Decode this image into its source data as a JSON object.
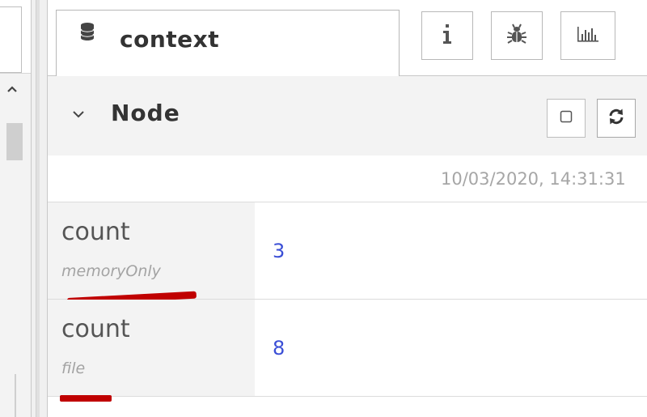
{
  "sidebar": {
    "active_tab": {
      "label": "context",
      "icon": "database-icon"
    },
    "tab_buttons": [
      {
        "name": "info-tab-button",
        "icon": "info-icon"
      },
      {
        "name": "debug-tab-button",
        "icon": "bug-icon"
      },
      {
        "name": "dashboard-tab-button",
        "icon": "bar-chart-icon"
      }
    ]
  },
  "node_section": {
    "title": "Node",
    "expanded": true,
    "auto_refresh_checked": false,
    "updated_at": "10/03/2020, 14:31:31"
  },
  "properties": [
    {
      "key": "count",
      "store": "memoryOnly",
      "value": "3"
    },
    {
      "key": "count",
      "store": "file",
      "value": "8"
    }
  ],
  "colors": {
    "value_text": "#3b4fd6",
    "annotation_underline": "#c00000",
    "header_bg": "#f3f3f3"
  }
}
